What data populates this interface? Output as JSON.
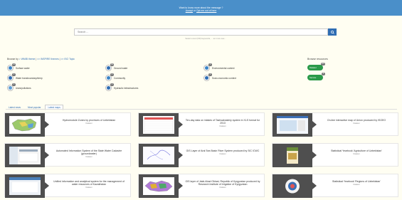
{
  "cookie": {
    "question": "Want to know more about the message ?",
    "accept": "Accept",
    "or": "or",
    "optout": "Opt me out of here"
  },
  "search": {
    "placeholder": "Search ...",
    "hint": "Select a text (OR) keywords, ... an more see..."
  },
  "browse_by": {
    "prefix": "Browse by",
    "options": [
      "> WMIB theme",
      ">> INSPIRE themes",
      ">> ISO Topic"
    ],
    "sep": "|"
  },
  "browse_resources": "Browse resources",
  "themes": [
    {
      "label": "Surface water",
      "badge": "14",
      "color": "#3b84c6"
    },
    {
      "label": "Ground water",
      "badge": "64",
      "color": "#2f6db3"
    },
    {
      "label": "Environmental context",
      "badge": "1",
      "color": "#3b84c6"
    },
    {
      "label": "Water transboundary/deep",
      "badge": "1",
      "color": "#2f6db3"
    },
    {
      "label": "Community",
      "badge": "4",
      "color": "#3b84c6"
    },
    {
      "label": "Socio-economic context",
      "badge": "2",
      "color": "#2f6db3"
    },
    {
      "label": "Uses/pollutions",
      "badge": "1",
      "color": "#5f9fd6"
    },
    {
      "label": "Hydraulic infrastructures",
      "badge": "1",
      "color": "#2f6db3"
    }
  ],
  "resources": [
    {
      "label": "Dataset",
      "badge": "187"
    },
    {
      "label": "Service",
      "badge": "6"
    }
  ],
  "tabs": [
    "Latest news",
    "Most popular",
    "Latest maps"
  ],
  "cards": [
    {
      "title": "Hydromodule Zones by provinces of Uzbekistan",
      "sub": "Dataset"
    },
    {
      "title": "Ten-day data on intakes of Tashsaknalmiy system in XLS format for 2013",
      "sub": "Dataset"
    },
    {
      "title": "On-line interactive map of Union produced by ISGEO",
      "sub": "Dataset"
    },
    {
      "title": "Automated Information System of the State Water Cadastre (groundwater)",
      "sub": "Dataset"
    },
    {
      "title": "GIS Layer of Aral Sea Basin River System produced by SIC ICWC",
      "sub": "Dataset"
    },
    {
      "title": "Statistical Yearbook 'Agriculture of Uzbekistan'",
      "sub": "Dataset"
    },
    {
      "title": "Unified information and analytical system for the management of water resources of Kazakhstan",
      "sub": "Dataset"
    },
    {
      "title": "GIS layer of Jalal-Abad Oblast, Republic of Kyrgyzstan produced by Research Institute of Irrigation of Kyrgyzstan",
      "sub": "Dataset"
    },
    {
      "title": "Statistical Yearbook 'Regions of Uzbekistan'",
      "sub": "Dataset"
    }
  ]
}
